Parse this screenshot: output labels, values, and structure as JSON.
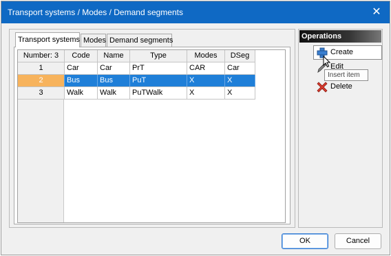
{
  "window": {
    "title": "Transport systems / Modes / Demand segments",
    "close_glyph": "✕"
  },
  "tabs": [
    {
      "label": "Transport systems"
    },
    {
      "label": "Modes"
    },
    {
      "label": "Demand segments"
    }
  ],
  "table": {
    "count_header": "Number: 3",
    "columns": [
      "Code",
      "Name",
      "Type",
      "Modes",
      "DSeg"
    ],
    "rows": [
      {
        "num": "1",
        "code": "Car",
        "name": "Car",
        "type": "PrT",
        "modes": "CAR",
        "dseg": "Car"
      },
      {
        "num": "2",
        "code": "Bus",
        "name": "Bus",
        "type": "PuT",
        "modes": "X",
        "dseg": "X"
      },
      {
        "num": "3",
        "code": "Walk",
        "name": "Walk",
        "type": "PuTWalk",
        "modes": "X",
        "dseg": "X"
      }
    ],
    "selected_row": 2
  },
  "operations": {
    "header": "Operations",
    "create_label": "Create",
    "edit_label": "Edit",
    "delete_label": "Delete",
    "tooltip": "Insert item"
  },
  "buttons": {
    "ok": "OK",
    "cancel": "Cancel"
  },
  "colors": {
    "titlebar": "#0f69c4",
    "selection": "#1f7fd8",
    "selected_row_number": "#f7b35c"
  },
  "icons": [
    "close-icon",
    "create-icon",
    "edit-icon",
    "delete-icon",
    "mouse-cursor-icon"
  ]
}
